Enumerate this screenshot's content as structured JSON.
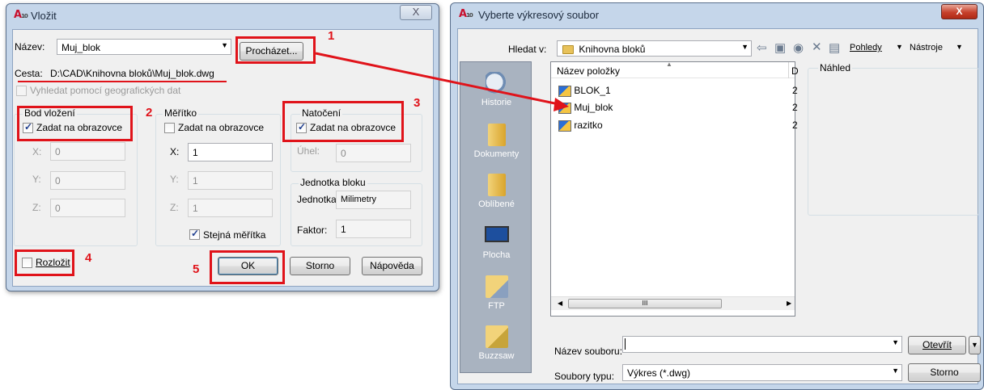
{
  "dialog_insert": {
    "title": "Vložit",
    "close_glyph": "X",
    "name_label": "Název:",
    "name_value": "Muj_blok",
    "browse_button": "Procházet...",
    "path_label": "Cesta:",
    "path_value": "D:\\CAD\\Knihovna bloků\\Muj_blok.dwg",
    "geo_checkbox_label": "Vyhledat pomocí geografických dat",
    "insertion": {
      "group_label": "Bod vložení",
      "on_screen_label": "Zadat na obrazovce",
      "on_screen_checked": true,
      "x_label": "X:",
      "x_value": "0",
      "y_label": "Y:",
      "y_value": "0",
      "z_label": "Z:",
      "z_value": "0"
    },
    "scale": {
      "group_label": "Měřítko",
      "on_screen_label": "Zadat na obrazovce",
      "on_screen_checked": false,
      "x_label": "X:",
      "x_value": "1",
      "y_label": "Y:",
      "y_value": "1",
      "z_label": "Z:",
      "z_value": "1",
      "uniform_label": "Stejná měřítka",
      "uniform_checked": true
    },
    "rotation": {
      "group_label": "Natočení",
      "on_screen_label": "Zadat na obrazovce",
      "on_screen_checked": true,
      "angle_label": "Úhel:",
      "angle_value": "0"
    },
    "block_unit": {
      "group_label": "Jednotka bloku",
      "unit_label": "Jednotka:",
      "unit_value": "Milimetry",
      "factor_label": "Faktor:",
      "factor_value": "1"
    },
    "explode_label": "Rozložit",
    "explode_checked": false,
    "ok_button": "OK",
    "cancel_button": "Storno",
    "help_button": "Nápověda"
  },
  "dialog_select": {
    "title": "Vyberte výkresový soubor",
    "close_glyph": "X",
    "look_in_label": "Hledat v:",
    "look_in_value": "Knihovna bloků",
    "views_menu": "Pohledy",
    "tools_menu": "Nástroje",
    "places": [
      "Historie",
      "Dokumenty",
      "Oblíbené",
      "Plocha",
      "FTP",
      "Buzzsaw"
    ],
    "column_name": "Název položky",
    "column_second": "D",
    "files": [
      {
        "name": "BLOK_1",
        "col2": "2"
      },
      {
        "name": "Muj_blok",
        "col2": "2"
      },
      {
        "name": "razitko",
        "col2": "2"
      }
    ],
    "scroll_left": "◀",
    "scroll_thumb_mark": "III",
    "scroll_right": "▶",
    "preview_label": "Náhled",
    "filename_label": "Název souboru:",
    "filename_value": "",
    "open_button": "Otevřít",
    "filetype_label": "Soubory typu:",
    "filetype_value": "Výkres (*.dwg)",
    "cancel_button": "Storno"
  },
  "annotations": {
    "step_1": "1",
    "step_2": "2",
    "step_3": "3",
    "step_4": "4",
    "step_5": "5",
    "highlight_color": "#e0131a"
  },
  "app_icon": {
    "letter": "A",
    "version": "10"
  }
}
